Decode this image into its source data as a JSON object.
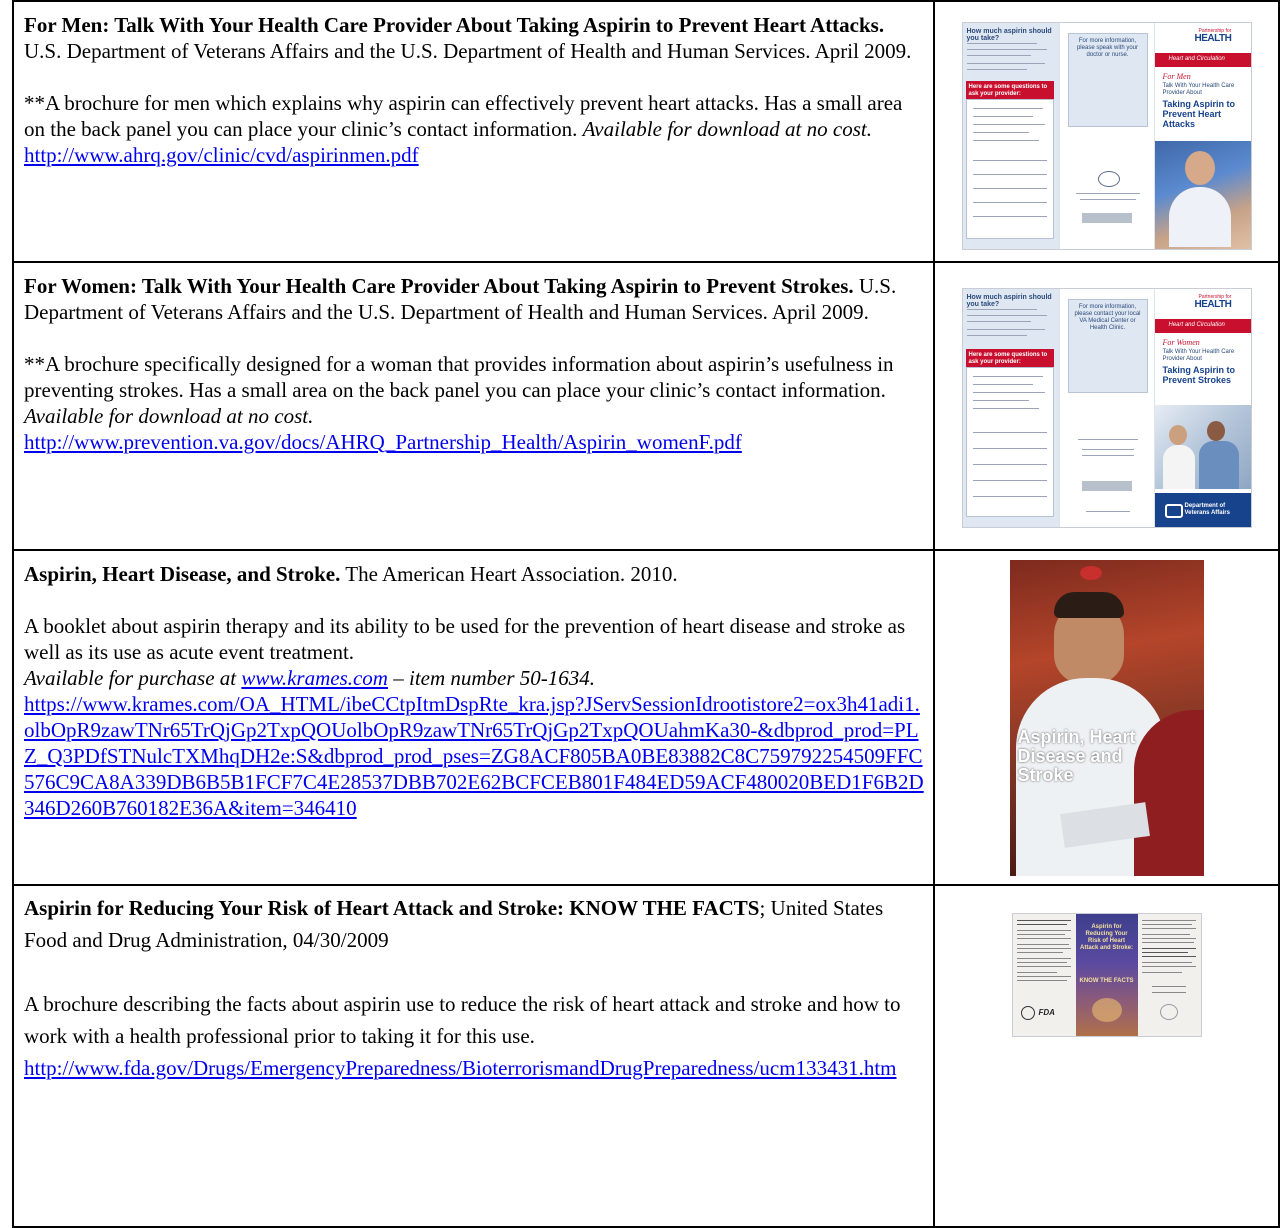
{
  "rows": [
    {
      "title": "For Men: Talk With Your Health Care Provider About Taking Aspirin to Prevent Heart Attacks.",
      "source": " U.S. Department of Veterans Affairs and the U.S. Department of Health and Human Services. April 2009.",
      "description": "**A brochure for men which explains why aspirin can effectively prevent heart attacks.  Has a small area on the back panel you can place your clinic’s contact information.  ",
      "availability": "Available for download at no cost.",
      "url": "http://www.ahrq.gov/clinic/cvd/aspirinmen.pdf"
    },
    {
      "title": "For Women: Talk With Your Health Care Provider About Taking Aspirin to Prevent Strokes.",
      "source": " U.S. Department of Veterans Affairs and the U.S. Department of Health and Human Services. April 2009.",
      "description": "**A brochure specifically designed for a woman that provides information about aspirin’s usefulness in preventing strokes. Has a small area on the back panel you can place your clinic’s contact information.  ",
      "availability": "Available for download at no cost.",
      "url": "http://www.prevention.va.gov/docs/AHRQ_Partnership_Health/Aspirin_womenF.pdf"
    },
    {
      "title": "Aspirin, Heart Disease, and Stroke.",
      "source": " The American Heart Association. 2010.",
      "description": "A booklet about aspirin therapy and its ability to be used for the prevention of heart disease and stroke as well as its use as acute event treatment.",
      "availability_prefix": "Available for purchase at ",
      "availability_link": "www.krames.com",
      "availability_suffix": " – item number 50-1634.",
      "url": "https://www.krames.com/OA_HTML/ibeCCtpItmDspRte_kra.jsp?JServSessionIdrootistore2=ox3h41adi1.olbOpR9zawTNr65TrQjGp2TxpQOUolbOpR9zawTNr65TrQjGp2TxpQOUahmKa30-&dbprod_prod=PLZ_Q3PDfSTNulcTXMhqDH2e:S&dbprod_prod_pses=ZG8ACF805BA0BE83882C8C759792254509FFC576C9CA8A339DB6B5B1FCF7C4E28537DBB702E62BCFCEB801F484ED59ACF480020BED1F6B2D346D260B760182E36A&item=346410"
    },
    {
      "title": "Aspirin for Reducing Your Risk of Heart Attack and Stroke: KNOW THE FACTS",
      "source": "; United States Food and Drug Administration, 04/30/2009",
      "description": "A brochure describing the facts about aspirin use to reduce the risk of heart attack and stroke and how to work with a health professional prior to taking it for this use.",
      "url": "http://www.fda.gov/Drugs/EmergencyPreparedness/BioterrorismandDrugPreparedness/ucm133431.htm"
    }
  ],
  "thumbs": {
    "men": {
      "p1_heading": "How much aspirin should you take?",
      "p1_box_heading": "Here are some questions to ask your provider:",
      "p2_note": "For more information, please speak with your doctor or nurse.",
      "p3_partnership": "Partnership for",
      "p3_brand": "HEALTH",
      "p3_band": "Heart and Circulation",
      "p3_for": "For Men",
      "p3_sub": "Talk With Your Health Care Provider About",
      "p3_title": "Taking Aspirin to Prevent Heart Attacks"
    },
    "women": {
      "p1_heading": "How much aspirin should you take?",
      "p1_box_heading": "Here are some questions to ask your provider:",
      "p2_note": "For more information, please contact your local VA Medical Center or Health Clinic.",
      "p3_partnership": "Partnership for",
      "p3_brand": "HEALTH",
      "p3_band": "Heart and Circulation",
      "p3_for": "For Women",
      "p3_sub": "Talk With Your Health Care Provider About",
      "p3_title": "Taking Aspirin to Prevent Strokes",
      "p3_va": "Department of Veterans Affairs"
    },
    "aha": {
      "title": "Aspirin, Heart Disease and Stroke"
    },
    "fda": {
      "title": "Aspirin for Reducing Your Risk of Heart Attack and Stroke:",
      "subtitle": "KNOW THE FACTS",
      "logo": "FDA"
    }
  },
  "colors": {
    "link": "#0000EE",
    "brochure_blue": "#17428c",
    "brochure_red": "#c8102e",
    "panel_bg": "#dfe7f2"
  }
}
